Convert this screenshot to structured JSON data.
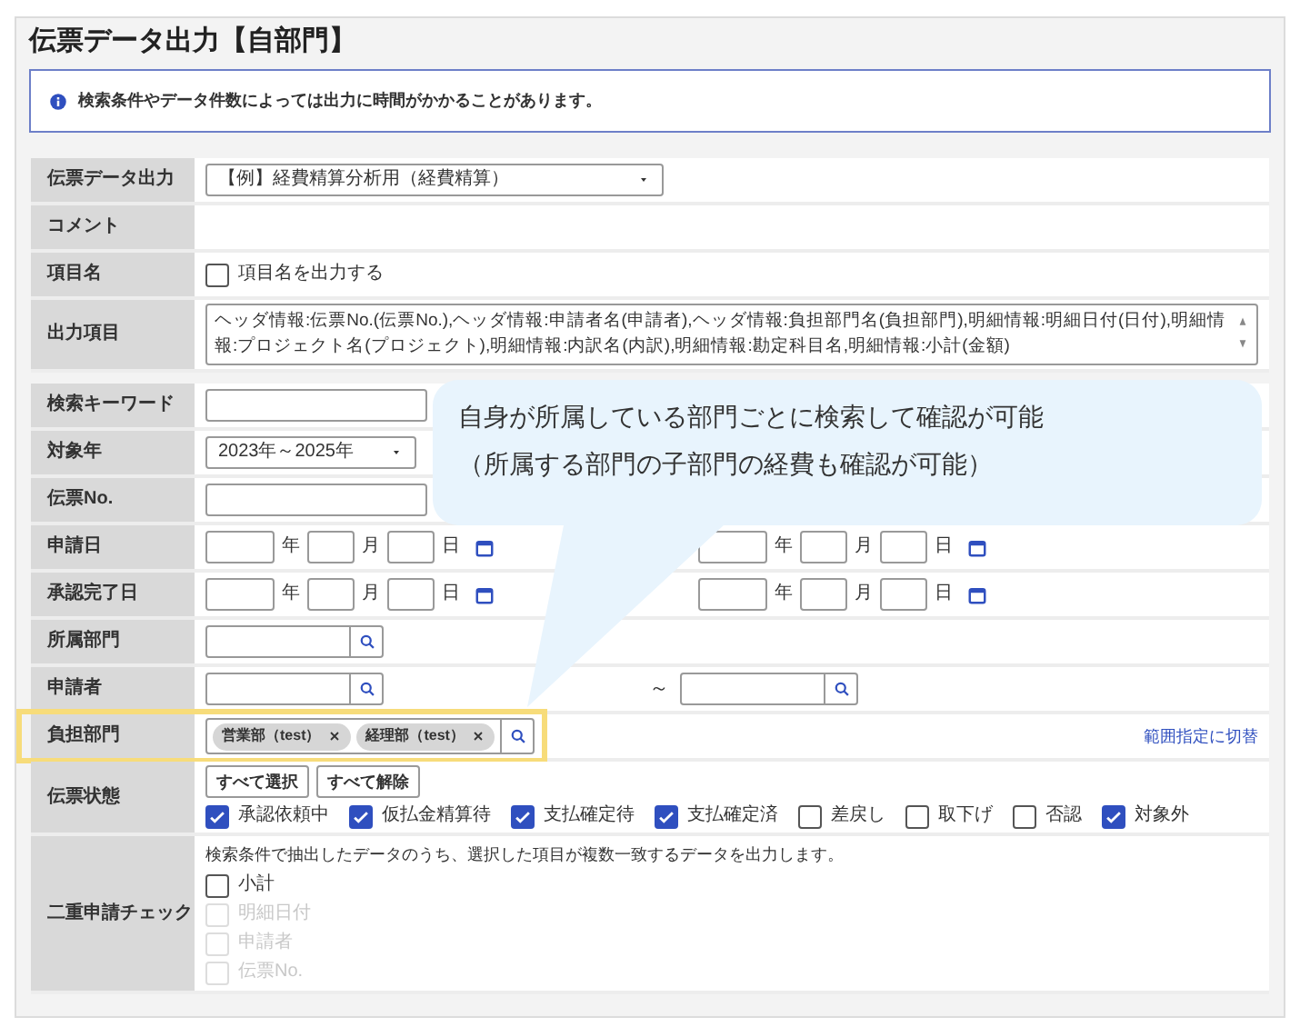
{
  "title": "伝票データ出力【自部門】",
  "notice": "検索条件やデータ件数によっては出力に時間がかかることがあります。",
  "form_top": [
    {
      "label": "伝票データ出力",
      "kind": "select",
      "value": "【例】経費精算分析用（経費精算）"
    },
    {
      "label": "コメント",
      "kind": "empty"
    },
    {
      "label": "項目名",
      "kind": "checkbox",
      "option": {
        "label": "項目名を出力する",
        "checked": false
      }
    },
    {
      "label": "出力項目",
      "kind": "textarea",
      "value": "ヘッダ情報:伝票No.(伝票No.),ヘッダ情報:申請者名(申請者),ヘッダ情報:負担部門名(負担部門),明細情報:明細日付(日付),明細情報:プロジェクト名(プロジェクト),明細情報:内訳名(内訳),明細情報:勘定科目名,明細情報:小計(金額)"
    }
  ],
  "form_search": [
    {
      "label": "検索キーワード",
      "kind": "text"
    },
    {
      "label": "対象年",
      "kind": "select",
      "value": "2023年～2025年"
    },
    {
      "label": "伝票No.",
      "kind": "text"
    },
    {
      "label": "申請日",
      "kind": "date_range",
      "from": [
        "年",
        "月",
        "日"
      ],
      "to": [
        "年",
        "月",
        "日"
      ]
    },
    {
      "label": "承認完了日",
      "kind": "date_range",
      "from": [
        "年",
        "月",
        "日"
      ],
      "to": [
        "年",
        "月",
        "日"
      ]
    },
    {
      "label": "所属部門",
      "kind": "search"
    },
    {
      "label": "申請者",
      "kind": "search_range",
      "separator": "～"
    },
    {
      "label": "負担部門",
      "kind": "tags",
      "highlighted": true,
      "tags": [
        "営業部（test）",
        "経理部（test）"
      ],
      "link": "範囲指定に切替"
    },
    {
      "label": "伝票状態",
      "kind": "status",
      "buttons": [
        "すべて選択",
        "すべて解除"
      ],
      "options": [
        {
          "label": "承認依頼中",
          "checked": true
        },
        {
          "label": "仮払金精算待",
          "checked": true
        },
        {
          "label": "支払確定待",
          "checked": true
        },
        {
          "label": "支払確定済",
          "checked": true
        },
        {
          "label": "差戻し",
          "checked": false
        },
        {
          "label": "取下げ",
          "checked": false
        },
        {
          "label": "否認",
          "checked": false
        },
        {
          "label": "対象外",
          "checked": true
        }
      ]
    },
    {
      "label": "二重申請チェック",
      "kind": "duplicate",
      "note": "検索条件で抽出したデータのうち、選択した項目が複数一致するデータを出力します。",
      "options": [
        {
          "label": "小計",
          "checked": false,
          "disabled": false
        },
        {
          "label": "明細日付",
          "checked": false,
          "disabled": true
        },
        {
          "label": "申請者",
          "checked": false,
          "disabled": true
        },
        {
          "label": "伝票No.",
          "checked": false,
          "disabled": true
        }
      ]
    }
  ],
  "callout": {
    "lines": [
      "自身が所属している部門ごとに検索して確認が可能",
      "（所属する部門の子部門の経費も確認が可能）"
    ]
  }
}
